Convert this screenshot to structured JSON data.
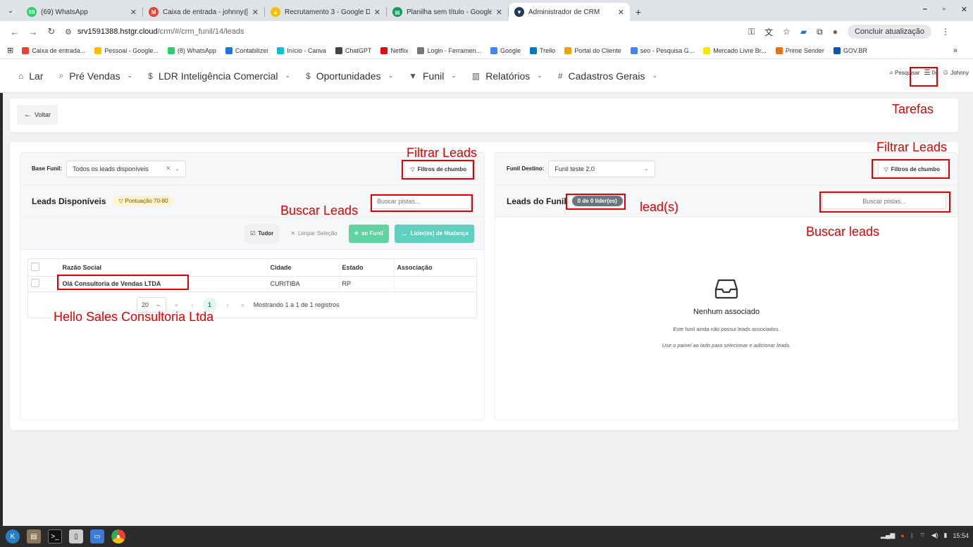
{
  "browser": {
    "tabs": [
      {
        "title": "(69) WhatsApp",
        "favicon_color": "#25d366",
        "favicon_text": "69"
      },
      {
        "title": "Caixa de entrada - johnny@",
        "favicon_color": "#ea4335",
        "favicon_text": "M"
      },
      {
        "title": "Recrutamento 3 - Google D",
        "favicon_color": "#fbbc04",
        "favicon_text": "▲"
      },
      {
        "title": "Planilha sem título - Google",
        "favicon_color": "#0f9d58",
        "favicon_text": "▤"
      },
      {
        "title": "Administrador de CRM",
        "favicon_color": "#1f3b57",
        "favicon_text": "▼",
        "active": true
      }
    ],
    "new_tab": "+",
    "url_host": "srv1591388.hstgr.cloud",
    "url_path": "/crm/#/crm_funil/14/leads",
    "update_button": "Concluir atualização",
    "bookmarks": [
      {
        "label": "Caixa de entrada...",
        "color": "#ea4335"
      },
      {
        "label": "Pessoal - Google...",
        "color": "#fbbc04"
      },
      {
        "label": "(8) WhatsApp",
        "color": "#25d366"
      },
      {
        "label": "Contabilizei",
        "color": "#1a73e8"
      },
      {
        "label": "Início - Canva",
        "color": "#00c4cc"
      },
      {
        "label": "ChatGPT",
        "color": "#444444"
      },
      {
        "label": "Netflix",
        "color": "#e50914"
      },
      {
        "label": "Login - Ferramen...",
        "color": "#777777"
      },
      {
        "label": "Google",
        "color": "#4285f4"
      },
      {
        "label": "Trello",
        "color": "#0079bf"
      },
      {
        "label": "Portal do Cliente",
        "color": "#f4a300"
      },
      {
        "label": "seo - Pesquisa G...",
        "color": "#4285f4"
      },
      {
        "label": "Mercado Livre Br...",
        "color": "#ffe600"
      },
      {
        "label": "Prime Sender",
        "color": "#e8710a"
      },
      {
        "label": "GOV.BR",
        "color": "#1351b4"
      }
    ],
    "bookmarks_more": "»"
  },
  "nav": {
    "items": [
      {
        "label": "Lar",
        "icon": "⌂",
        "chevron": false
      },
      {
        "label": "Pré Vendas",
        "icon": "⌕",
        "chevron": true
      },
      {
        "label": "LDR Inteligência Comercial",
        "icon": "$",
        "chevron": true
      },
      {
        "label": "Oportunidades",
        "icon": "$",
        "chevron": true
      },
      {
        "label": "Funil",
        "icon": "▼",
        "chevron": true
      },
      {
        "label": "Relatórios",
        "icon": "▥",
        "chevron": true
      },
      {
        "label": "Cadastros Gerais",
        "icon": "#",
        "chevron": true
      }
    ],
    "search": "Pesquisar",
    "tasks": "0s",
    "user": "Johnny"
  },
  "back_button": "Voltar",
  "left_panel": {
    "base_label": "Base Funil:",
    "base_value": "Todos os leads disponíveis",
    "filter_button": "Filtros de chumbo",
    "title": "Leads Disponíveis",
    "score_badge": "Pontuação 70-80",
    "search_placeholder": "Buscar pistas...",
    "toolbar": {
      "select_all": "Tudor",
      "clear": "Limpar Seleção",
      "add": "ao Funil",
      "move": "Líder(es) de Mudança"
    },
    "table": {
      "headers": [
        "Razão Social",
        "Cidade",
        "Estado",
        "Associação"
      ],
      "rows": [
        {
          "razao": "Olá Consultoria de Vendas LTDA",
          "cidade": "CURITIBA",
          "estado": "RP",
          "assoc": ""
        }
      ]
    },
    "pager": {
      "page_size": "20",
      "first": "«",
      "prev": "‹",
      "current": "1",
      "next": "›",
      "last": "»",
      "summary": "Mostrando 1 a 1 de 1 registros"
    }
  },
  "right_panel": {
    "dest_label": "Funil Destino:",
    "dest_value": "Funil teste 2.0",
    "filter_button": "Filtros de chumbo",
    "title": "Leads do Funil",
    "count_badge": "0 de 0 líder(es)",
    "search_placeholder": "Buscar pistas...",
    "empty_title": "Nenhum associado",
    "empty_sub": "Este funil ainda não possui leads associados.",
    "empty_hint": "Use o painel ao lado para selecionar e adicionar leads."
  },
  "annotations": {
    "tarefas": "Tarefas",
    "filtrar_left": "Filtrar Leads",
    "filtrar_right": "Filtrar Leads",
    "buscar_left": "Buscar Leads",
    "buscar_right": "Buscar leads",
    "leads_badge": "lead(s)",
    "hello": "Hello Sales Consultoria Ltda",
    "color": "#e00000"
  },
  "taskbar": {
    "clock": "15:54"
  }
}
